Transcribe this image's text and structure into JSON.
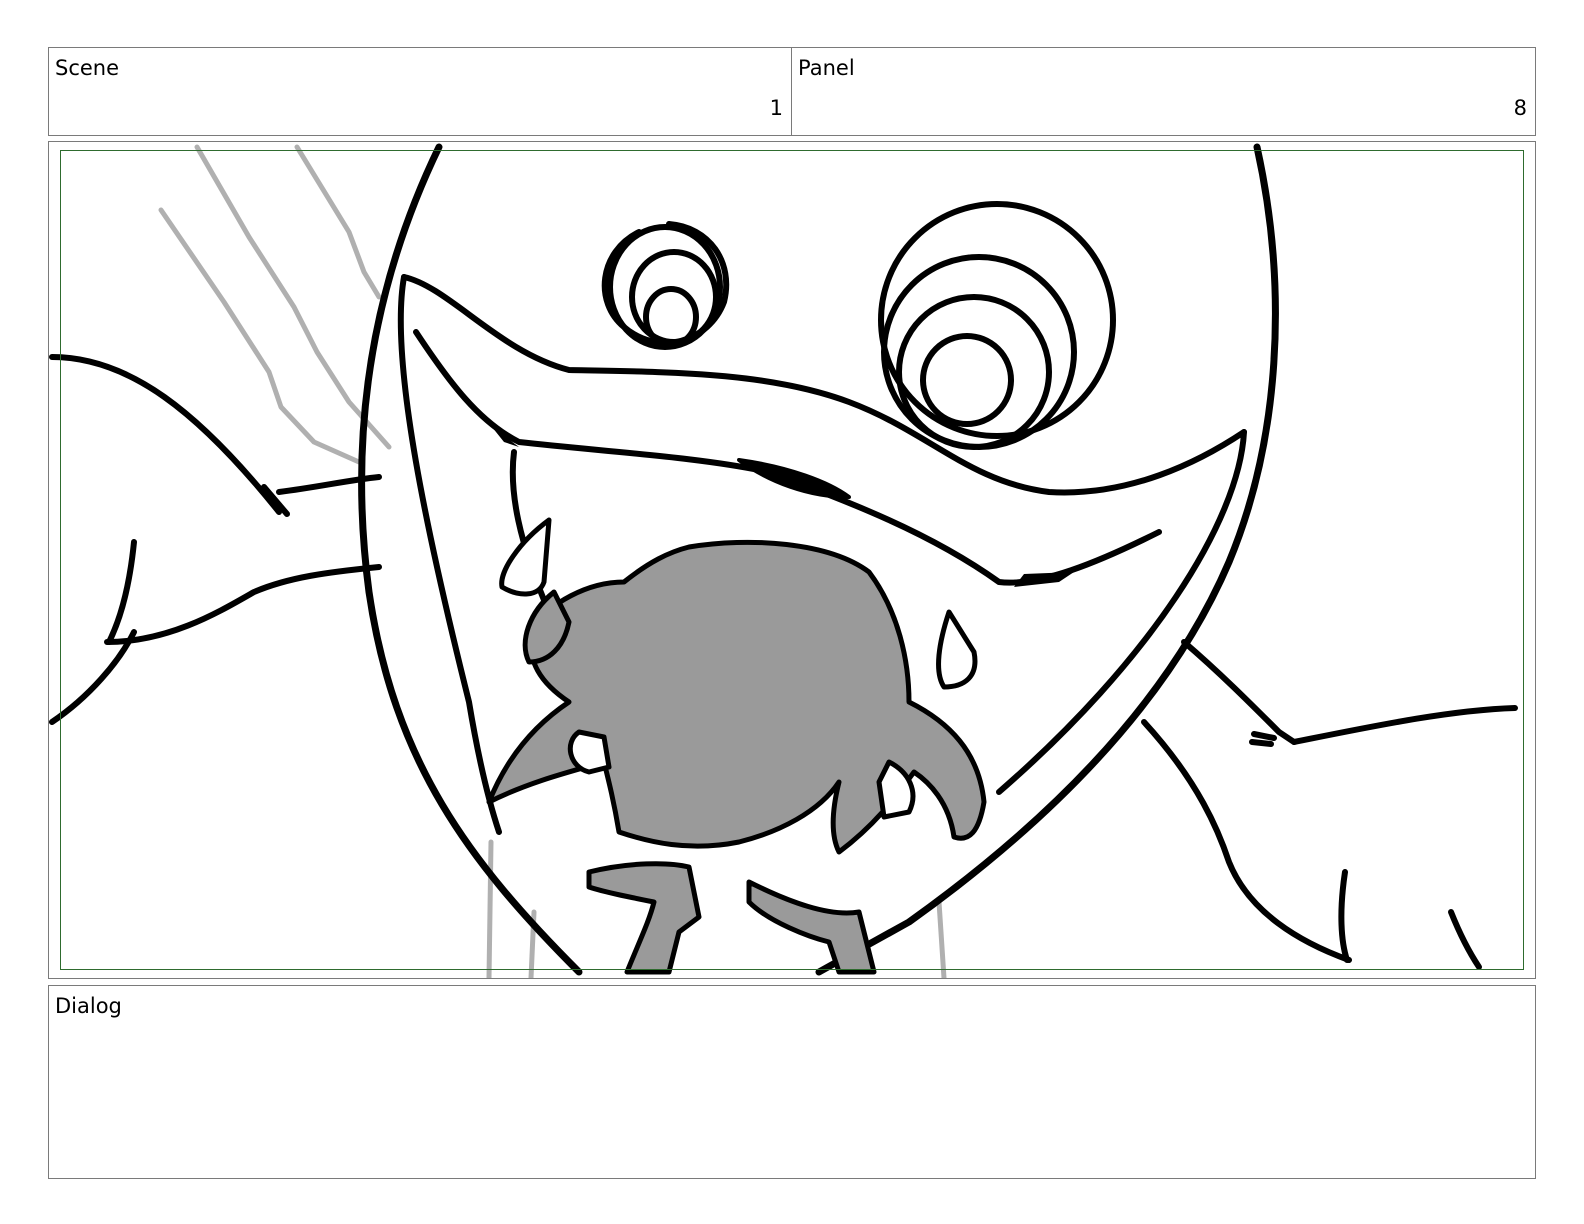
{
  "scene": {
    "label": "Scene",
    "number": "1"
  },
  "panel": {
    "label": "Panel",
    "number": "8"
  },
  "dialog": {
    "label": "Dialog",
    "text": ""
  },
  "colors": {
    "border": "#7a7a7a",
    "safe_area": "#2e6b2e",
    "ink": "#000000",
    "tone": "#9a9a9a",
    "sketch": "#b0b0b0"
  }
}
